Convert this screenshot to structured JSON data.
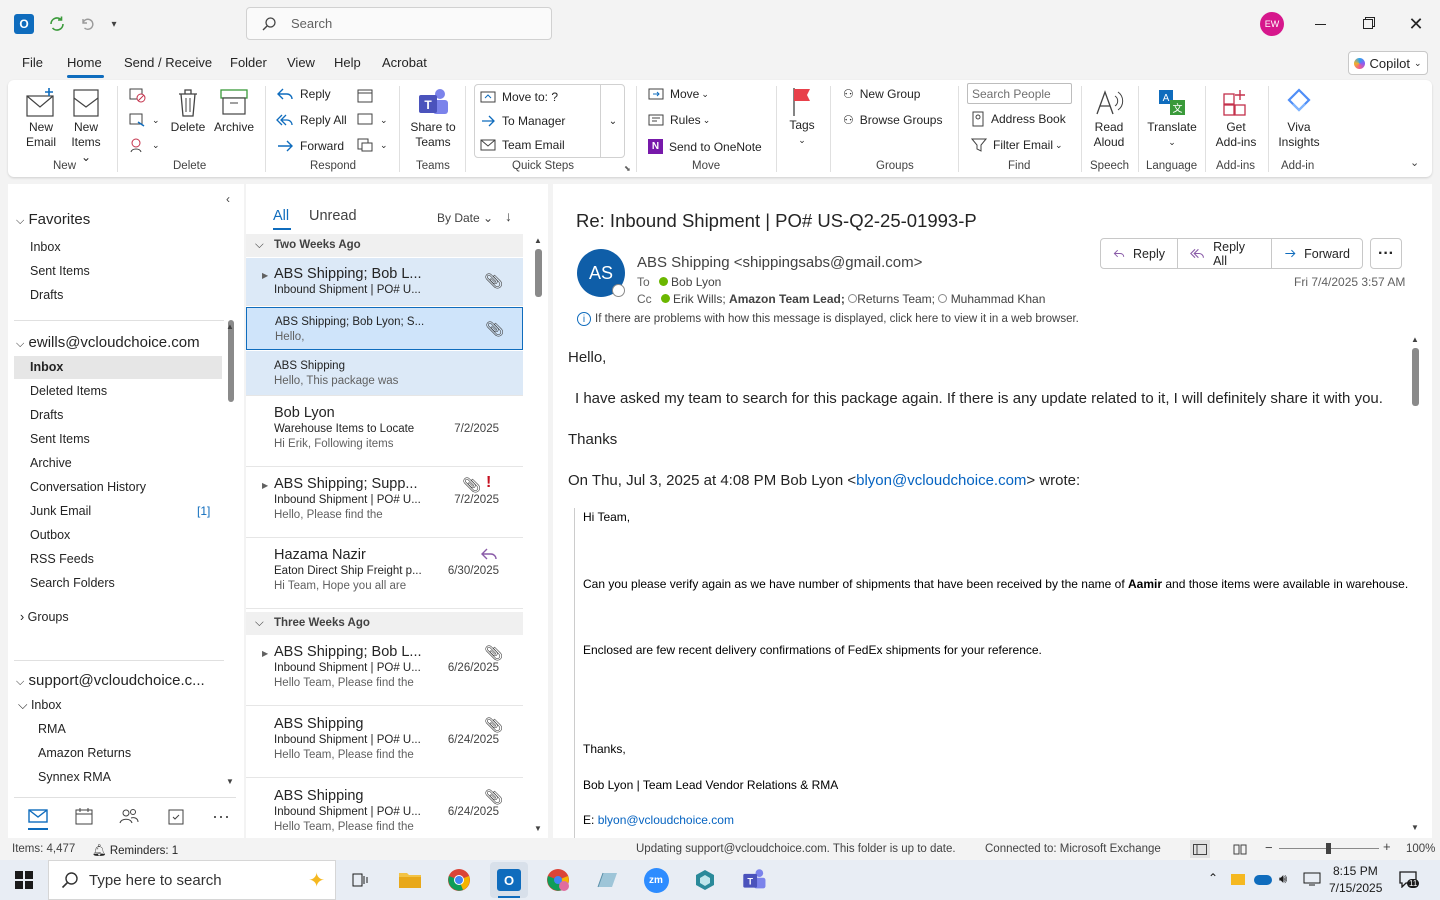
{
  "titlebar": {
    "search_placeholder": "Search",
    "avatar_initials": "EW"
  },
  "menu": {
    "tabs": [
      "File",
      "Home",
      "Send / Receive",
      "Folder",
      "View",
      "Help",
      "Acrobat"
    ],
    "copilot": "Copilot"
  },
  "ribbon": {
    "new_email": [
      "New",
      "Email"
    ],
    "new_items": [
      "New",
      "Items"
    ],
    "delete": "Delete",
    "archive": "Archive",
    "reply": "Reply",
    "reply_all": "Reply All",
    "forward": "Forward",
    "share_teams": [
      "Share to",
      "Teams"
    ],
    "quick_steps": [
      "Move to: ?",
      "To Manager",
      "Team Email"
    ],
    "move": "Move",
    "rules": "Rules",
    "send_onenote": "Send to OneNote",
    "tags": "Tags",
    "new_group": "New Group",
    "browse_groups": "Browse Groups",
    "search_people": "Search People",
    "address_book": "Address Book",
    "filter_email": "Filter Email",
    "read_aloud": [
      "Read",
      "Aloud"
    ],
    "translate": "Translate",
    "get_addins": [
      "Get",
      "Add-ins"
    ],
    "viva": [
      "Viva",
      "Insights"
    ],
    "groups": [
      "New",
      "Delete",
      "Respond",
      "Teams",
      "Quick Steps",
      "Move",
      "Groups",
      "Find",
      "Speech",
      "Language",
      "Add-ins",
      "Add-in"
    ]
  },
  "nav": {
    "favorites": "Favorites",
    "fav_items": [
      "Inbox",
      "Sent Items",
      "Drafts"
    ],
    "account1": "ewills@vcloudchoice.com",
    "acc1_items": [
      "Inbox",
      "Deleted Items",
      "Drafts",
      "Sent Items",
      "Archive",
      "Conversation History",
      "Junk Email",
      "Outbox",
      "RSS Feeds",
      "Search Folders"
    ],
    "junk_count": "[1]",
    "groups": "Groups",
    "account2": "support@vcloudchoice.c...",
    "acc2_inbox": "Inbox",
    "acc2_items": [
      "RMA",
      "Amazon Returns",
      "Synnex RMA"
    ]
  },
  "list": {
    "filter_all": "All",
    "filter_unread": "Unread",
    "sort": "By Date",
    "group1": "Two Weeks Ago",
    "group2": "Three Weeks Ago",
    "messages": [
      {
        "sender": "ABS Shipping;  Bob L...",
        "subject": "Inbound Shipment | PO# U...",
        "preview": "",
        "date": ""
      },
      {
        "sender": "ABS Shipping;  Bob Lyon;  S...",
        "subject": "Hello,",
        "preview": "",
        "date": ""
      },
      {
        "sender": "ABS Shipping",
        "subject": "Hello,  This package was",
        "preview": "",
        "date": ""
      },
      {
        "sender": "Bob Lyon",
        "subject": "Warehouse Items to Locate",
        "preview": "Hi Erik,  Following items",
        "date": "7/2/2025"
      },
      {
        "sender": "ABS Shipping;  Supp...",
        "subject": "Inbound Shipment | PO# U...",
        "preview": "Hello,  Please find the",
        "date": "7/2/2025"
      },
      {
        "sender": "Hazama Nazir",
        "subject": "Eaton Direct Ship Freight p...",
        "preview": "Hi Team,  Hope you all are",
        "date": "6/30/2025"
      },
      {
        "sender": "ABS Shipping;  Bob L...",
        "subject": "Inbound Shipment | PO# U...",
        "preview": "Hello Team,  Please find the",
        "date": "6/26/2025"
      },
      {
        "sender": "ABS Shipping",
        "subject": "Inbound Shipment | PO# U...",
        "preview": "Hello Team,  Please find the",
        "date": "6/24/2025"
      },
      {
        "sender": "ABS Shipping",
        "subject": "Inbound Shipment | PO# U...",
        "preview": "Hello Team,  Please find the",
        "date": "6/24/2025"
      }
    ]
  },
  "reading": {
    "subject": "Re: Inbound Shipment | PO# US-Q2-25-01993-P",
    "avatar": "AS",
    "from": "ABS Shipping <shippingsabs@gmail.com>",
    "to_label": "To",
    "to": "Bob Lyon",
    "cc_label": "Cc",
    "cc1": "Erik Wills;",
    "cc2": "Amazon Team Lead;",
    "cc3": "Returns Team;",
    "cc4": "Muhammad Khan",
    "reply": "Reply",
    "reply_all": "Reply All",
    "forward": "Forward",
    "datetime": "Fri 7/4/2025 3:57 AM",
    "info": "If there are problems with how this message is displayed, click here to view it in a web browser.",
    "greeting": "Hello,",
    "line1": "I have asked my team to search for this package again. If there is any update related to it, I will definitely share it with you.",
    "thanks": "Thanks",
    "quote_header_pre": "On Thu, Jul 3, 2025 at 4:08 PM Bob Lyon <",
    "quote_header_link": "blyon@vcloudchoice.com",
    "quote_header_post": "> wrote:",
    "q_hi": "Hi Team,",
    "q_line1_pre": "Can you please verify again as we have number of shipments that have been received by the name of ",
    "q_line1_bold": "Aamir",
    "q_line1_post": " and those items were available in warehouse.",
    "q_line2": "Enclosed are few recent delivery confirmations of FedEx shipments for your reference.",
    "q_thanks": "Thanks,",
    "q_sig": "Bob Lyon | Team Lead Vendor Relations & RMA",
    "q_email_label": "E:",
    "q_email": "blyon@vcloudchoice.com"
  },
  "status": {
    "items": "Items: 4,477",
    "reminders": "Reminders: 1",
    "updating": "Updating support@vcloudchoice.com.  This folder is up to date.",
    "connected": "Connected to: Microsoft Exchange",
    "zoom": "100%"
  },
  "taskbar": {
    "search_placeholder": "Type here to search",
    "time": "8:15 PM",
    "date": "7/15/2025",
    "notif_count": "11"
  }
}
